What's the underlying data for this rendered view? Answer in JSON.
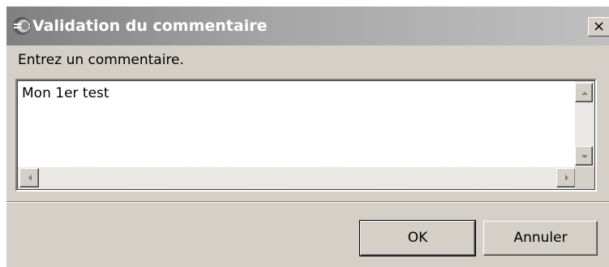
{
  "window": {
    "title": "Validation du commentaire",
    "close_glyph": "×",
    "title_icon": "app-icon"
  },
  "dialog": {
    "prompt": "Entrez un commentaire.",
    "comment_value": "Mon 1er test"
  },
  "buttons": {
    "ok_label": "OK",
    "cancel_label": "Annuler"
  },
  "colors": {
    "titlebar_start": "#808080",
    "titlebar_end": "#c0c0c0",
    "face": "#d4d0c8"
  }
}
